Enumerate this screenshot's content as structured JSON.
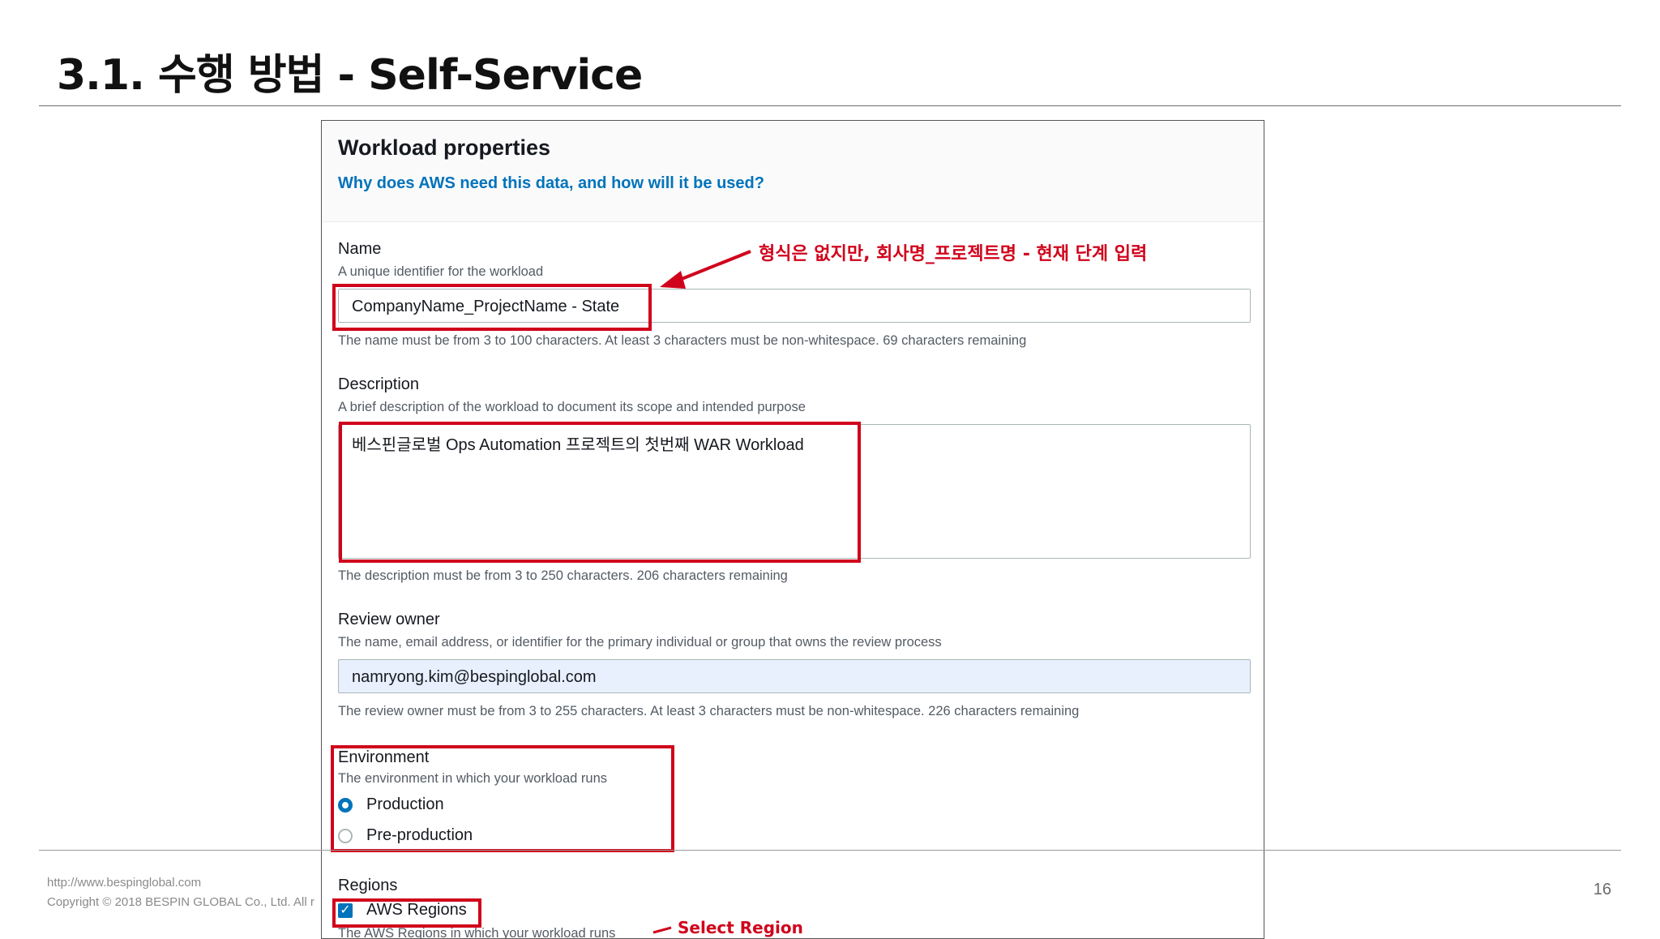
{
  "slide": {
    "title": "3.1. 수행 방법 - Self-Service",
    "footer_url": "http://www.bespinglobal.com",
    "footer_copyright": "Copyright © 2018 BESPIN GLOBAL Co., Ltd. All r",
    "page_number": "16"
  },
  "panel": {
    "title": "Workload properties",
    "help_link": "Why does AWS need this data, and how will it be used?"
  },
  "fields": {
    "name": {
      "label": "Name",
      "hint": "A unique identifier for the workload",
      "value": "CompanyName_ProjectName - State",
      "constraint": "The name must be from 3 to 100 characters. At least 3 characters must be non-whitespace. 69 characters remaining"
    },
    "description": {
      "label": "Description",
      "hint": "A brief description of the workload to document its scope and intended purpose",
      "value": "베스핀글로벌 Ops Automation 프로젝트의 첫번째 WAR Workload",
      "constraint": "The description must be from 3 to 250 characters. 206 characters remaining"
    },
    "review_owner": {
      "label": "Review owner",
      "hint": "The name, email address, or identifier for the primary individual or group that owns the review process",
      "value": "namryong.kim@bespinglobal.com",
      "constraint": "The review owner must be from 3 to 255 characters. At least 3 characters must be non-whitespace. 226 characters remaining"
    },
    "environment": {
      "label": "Environment",
      "hint": "The environment in which your workload runs",
      "options": [
        {
          "label": "Production",
          "selected": true
        },
        {
          "label": "Pre-production",
          "selected": false
        }
      ]
    },
    "regions": {
      "label": "Regions",
      "checkbox_label": "AWS Regions",
      "checked": true,
      "hint": "The AWS Regions in which your workload runs"
    }
  },
  "annotations": {
    "name_note": "형식은 없지만, 회사명_프로젝트명 - 현재 단계 입력",
    "region_note": "Select Region"
  },
  "colors": {
    "highlight": "#d0021b",
    "link": "#0073bb",
    "autofill_bg": "#e8f0fe"
  }
}
